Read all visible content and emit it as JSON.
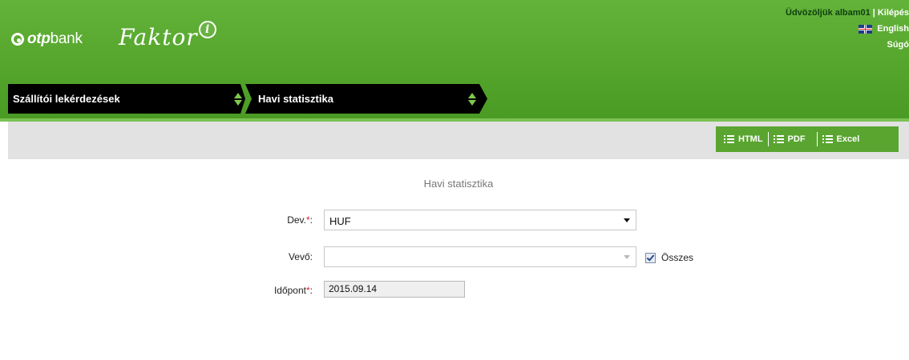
{
  "header": {
    "brand": {
      "bold": "otp",
      "light": "bank"
    },
    "product": {
      "name": "Faktor",
      "badge": "i"
    },
    "user": {
      "welcome": "Üdvözöljük albam01",
      "logout": "Kilépés",
      "language": "English",
      "help": "Súgó"
    }
  },
  "breadcrumbs": [
    {
      "label": "Szállítói lekérdezések"
    },
    {
      "label": "Havi statisztika"
    }
  ],
  "toolbar": {
    "html_label": "HTML",
    "pdf_label": "PDF",
    "excel_label": "Excel"
  },
  "form": {
    "title": "Havi statisztika",
    "currency": {
      "label": "Dev.",
      "required_mark": "*",
      "suffix": ":",
      "value": "HUF"
    },
    "customer": {
      "label": "Vevő:",
      "value": "",
      "all_label": "Összes",
      "all_checked": true
    },
    "date": {
      "label": "Időpont",
      "required_mark": "*",
      "suffix": ":",
      "value": "2015.09.14"
    }
  },
  "colors": {
    "header_green": "#58a82f",
    "export_green": "#59a530",
    "required_red": "#d9232d",
    "tab_black": "#000000"
  }
}
